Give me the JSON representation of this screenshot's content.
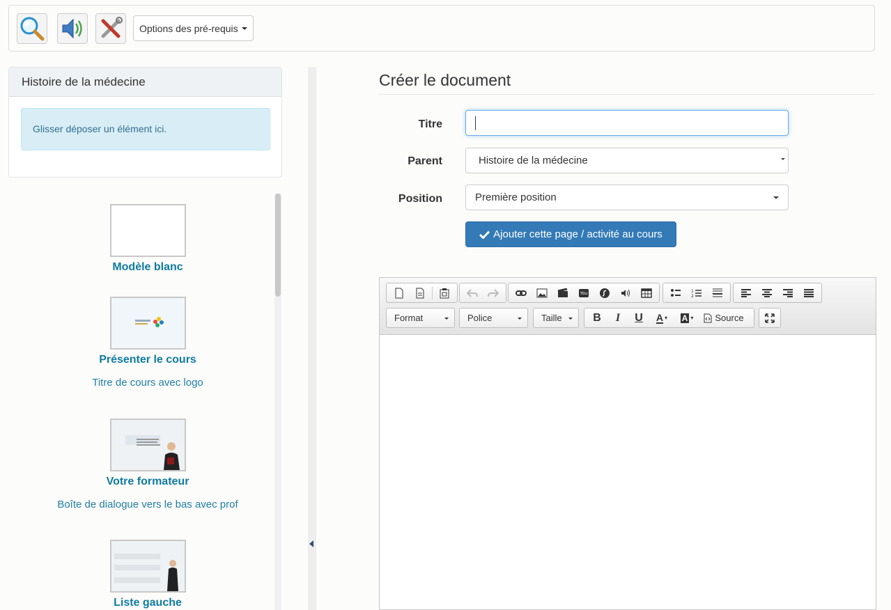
{
  "toolbar": {
    "icons": [
      "search-magnifier-icon",
      "audio-speaker-icon",
      "settings-tools-icon"
    ],
    "prerequisites_label": "Options des pré-requis"
  },
  "course_panel": {
    "title": "Histoire de la médecine",
    "drop_hint": "Glisser déposer un élément ici."
  },
  "templates": [
    {
      "title": "Modèle blanc",
      "desc": ""
    },
    {
      "title": "Présenter le cours",
      "desc": "Titre de cours avec logo"
    },
    {
      "title": "Votre formateur",
      "desc": "Boîte de dialogue vers le bas avec prof"
    },
    {
      "title": "Liste gauche",
      "desc": ""
    }
  ],
  "form": {
    "heading": "Créer le document",
    "title_label": "Titre",
    "title_value": "",
    "parent_label": "Parent",
    "parent_value": "Histoire de la médecine",
    "position_label": "Position",
    "position_value": "Première position",
    "submit_label": "Ajouter cette page / activité au cours"
  },
  "editor": {
    "format_label": "Format",
    "font_label": "Police",
    "size_label": "Taille",
    "source_label": "Source",
    "bold_glyph": "B",
    "italic_glyph": "I",
    "underline_glyph": "U",
    "text_color_glyph": "A",
    "bg_color_glyph": "A"
  },
  "colors": {
    "primary": "#337ab7",
    "link": "#0f7ba0",
    "info_bg": "#d9edf7"
  }
}
